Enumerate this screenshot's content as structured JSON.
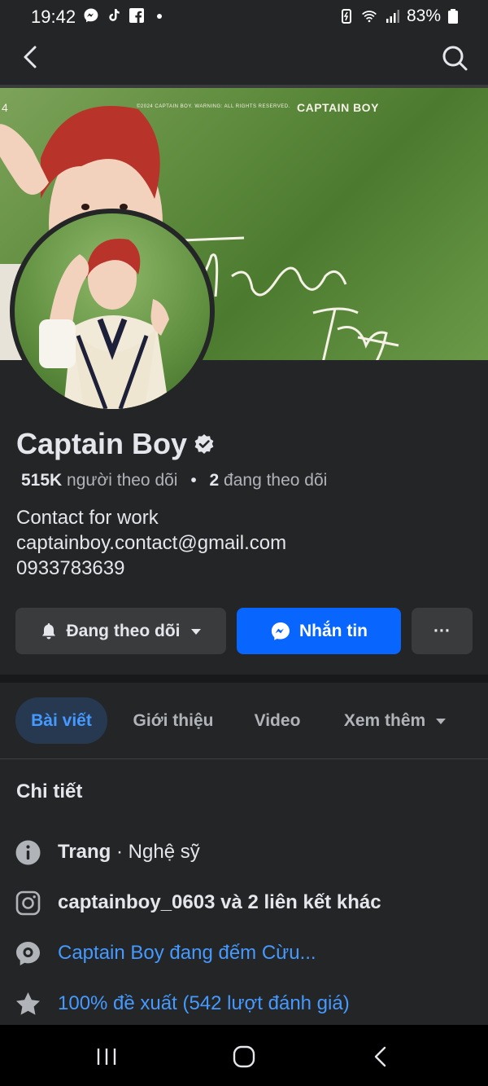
{
  "status_bar": {
    "time": "19:42",
    "battery": "83%",
    "left_icons": [
      "messenger-icon",
      "tiktok-icon",
      "facebook-icon",
      "dot-icon"
    ],
    "right_icons": [
      "battery-saver-icon",
      "wifi-icon",
      "signal-icon",
      "battery-icon"
    ]
  },
  "nav": {
    "back_icon": "chevron-left-icon",
    "search_icon": "search-icon"
  },
  "cover": {
    "brand": "CAPTAIN BOY",
    "small_text": "©2024 CAPTAIN BOY. WARNING: ALL RIGHTS RESERVED.",
    "corner_number": "4"
  },
  "profile": {
    "name": "Captain Boy",
    "followers_count": "515K",
    "followers_label": "người theo dõi",
    "following_count": "2",
    "following_label": "đang theo dõi",
    "bio_line1": "Contact for work",
    "bio_line2": "captainboy.contact@gmail.com",
    "bio_line3": "0933783639"
  },
  "actions": {
    "follow_label": "Đang theo dõi",
    "message_label": "Nhắn tin",
    "more_label": "···"
  },
  "tabs": [
    {
      "label": "Bài viết",
      "active": true
    },
    {
      "label": "Giới thiệu",
      "active": false
    },
    {
      "label": "Video",
      "active": false
    },
    {
      "label": "Xem thêm",
      "active": false
    }
  ],
  "details": {
    "title": "Chi tiết",
    "page_type_bold": "Trang",
    "page_type_rest": " · Nghệ sỹ",
    "instagram": "captainboy_0603 và 2 liên kết khác",
    "status": "Captain Boy đang đếm Cừu...",
    "rating": "100% đề xuất (542 lượt đánh giá)"
  },
  "colors": {
    "background": "#242526",
    "accent_blue": "#0866ff",
    "link_blue": "#4599ff",
    "active_tab_bg": "#263951"
  }
}
